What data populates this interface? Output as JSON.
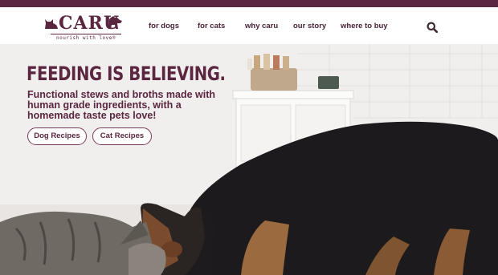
{
  "brand": {
    "name": "CARU",
    "tagline": "nourish with love®"
  },
  "nav": {
    "items": [
      {
        "label": "for dogs"
      },
      {
        "label": "for cats"
      },
      {
        "label": "why caru"
      },
      {
        "label": "our story"
      },
      {
        "label": "where to buy"
      }
    ],
    "search_icon": "search-icon"
  },
  "hero": {
    "headline": "FEEDING IS BELIEVING.",
    "subhead": "Functional stews and broths made with human grade ingredients, with a homemade taste pets love!",
    "buttons": [
      {
        "label": "Dog Recipes"
      },
      {
        "label": "Cat Recipes"
      }
    ]
  },
  "colors": {
    "brand": "#5b2640",
    "topbar": "#5b2640",
    "button_border": "#7a3a57",
    "nav_text": "#4a2236"
  }
}
